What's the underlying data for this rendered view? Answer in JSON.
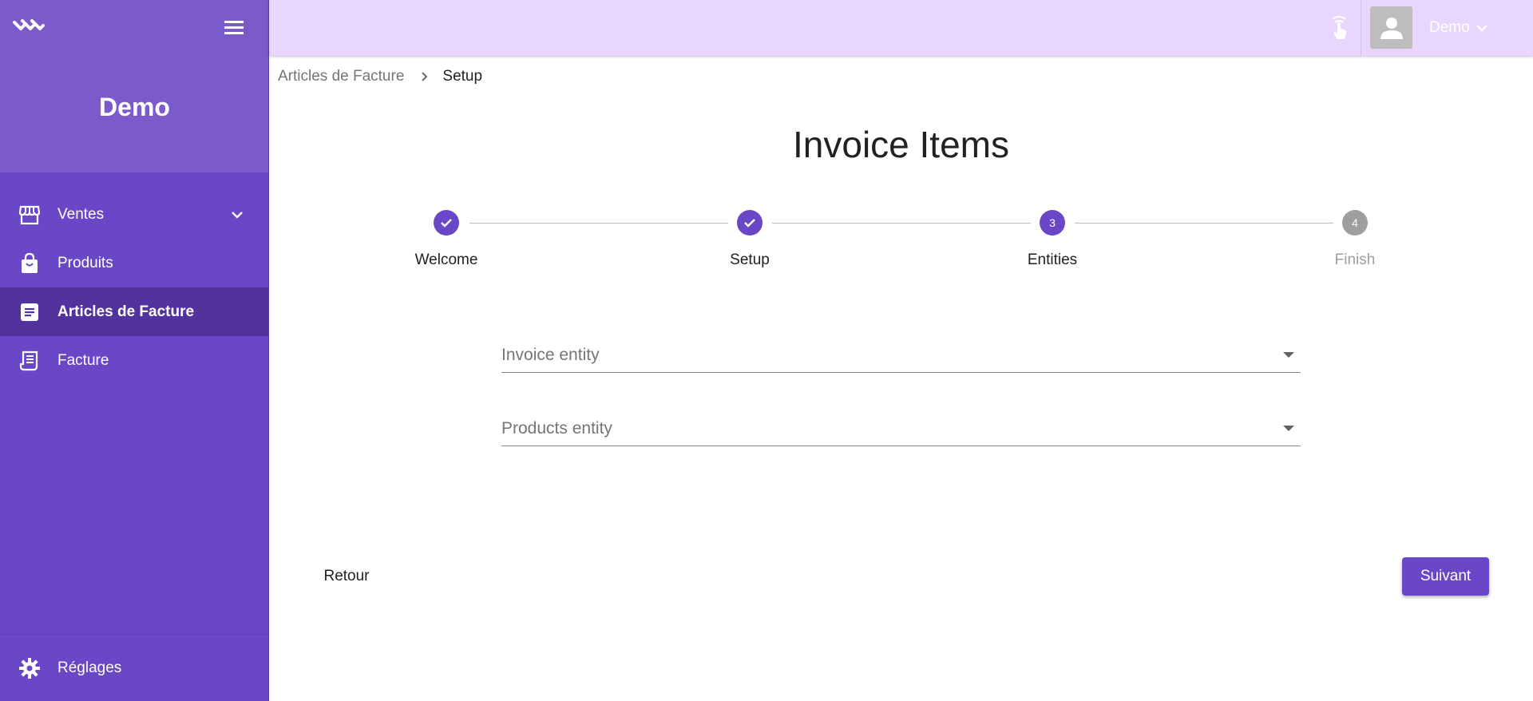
{
  "app": {
    "brand": "Demo"
  },
  "sidebar": {
    "items": [
      {
        "label": "Ventes",
        "icon": "store-icon",
        "expandable": true
      },
      {
        "label": "Produits",
        "icon": "shopping-bag-icon"
      },
      {
        "label": "Articles de Facture",
        "icon": "article-icon",
        "active": true
      },
      {
        "label": "Facture",
        "icon": "receipt-icon"
      }
    ],
    "settings_label": "Réglages"
  },
  "header": {
    "user_name": "Demo"
  },
  "breadcrumb": {
    "parent": "Articles de Facture",
    "current": "Setup"
  },
  "page": {
    "title": "Invoice Items"
  },
  "stepper": {
    "steps": [
      {
        "label": "Welcome",
        "state": "done",
        "number": "1"
      },
      {
        "label": "Setup",
        "state": "done",
        "number": "2"
      },
      {
        "label": "Entities",
        "state": "current",
        "number": "3"
      },
      {
        "label": "Finish",
        "state": "todo",
        "number": "4"
      }
    ]
  },
  "form": {
    "invoice_entity_label": "Invoice entity",
    "products_entity_label": "Products entity"
  },
  "actions": {
    "back_label": "Retour",
    "next_label": "Suivant"
  },
  "colors": {
    "primary": "#6a47c6",
    "header_bg": "#e9d6ff",
    "active_item": "#52339e"
  }
}
